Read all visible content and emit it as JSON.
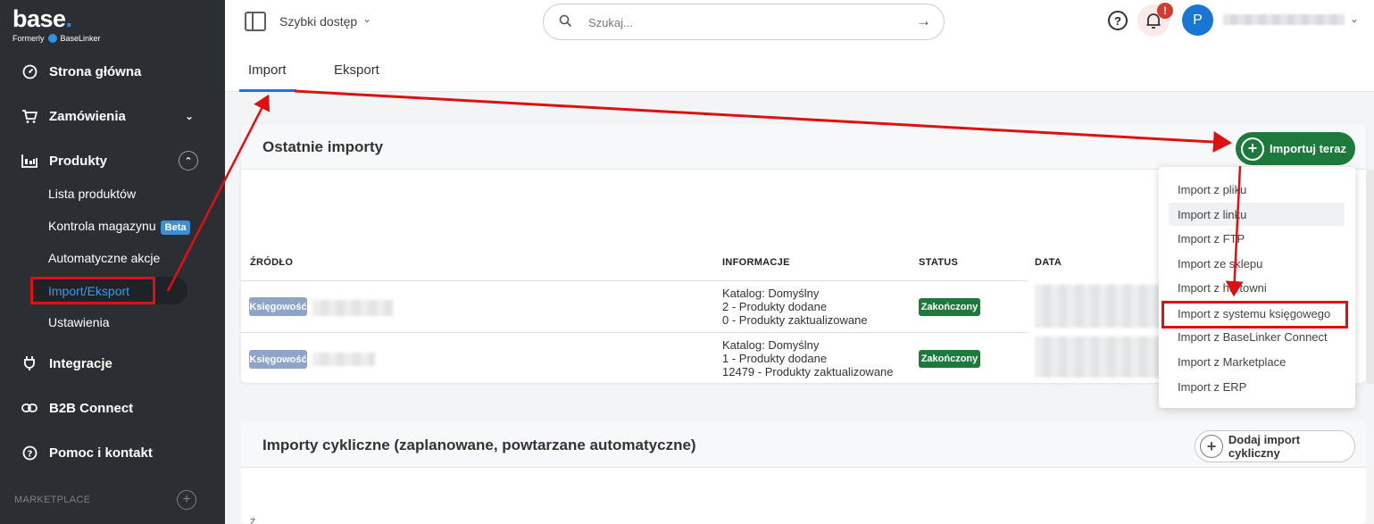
{
  "brand": {
    "name": "base",
    "dot": ".",
    "formerly": "Formerly",
    "formerly_brand": "BaseLinker"
  },
  "sidebar": {
    "items": [
      {
        "label": "Strona główna",
        "icon": "dashboard-icon"
      },
      {
        "label": "Zamówienia",
        "icon": "cart-icon"
      },
      {
        "label": "Produkty",
        "icon": "products-icon"
      },
      {
        "label": "Integracje",
        "icon": "plug-icon"
      },
      {
        "label": "B2B Connect",
        "icon": "link-icon"
      },
      {
        "label": "Pomoc i kontakt",
        "icon": "help-circle-icon"
      }
    ],
    "sub_items": [
      {
        "label": "Lista produktów"
      },
      {
        "label": "Kontrola magazynu",
        "badge": "Beta"
      },
      {
        "label": "Automatyczne akcje"
      },
      {
        "label": "Import/Eksport",
        "active": true
      },
      {
        "label": "Ustawienia"
      }
    ],
    "section_label": "MARKETPLACE"
  },
  "topbar": {
    "quick_access": "Szybki dostęp",
    "search_placeholder": "Szukaj...",
    "help": "?",
    "notification_badge": "!",
    "avatar_initial": "P"
  },
  "tabs": [
    {
      "label": "Import",
      "active": true
    },
    {
      "label": "Eksport",
      "active": false
    }
  ],
  "recent_imports": {
    "title": "Ostatnie importy",
    "import_button": "Importuj teraz",
    "columns": [
      "ŹRÓDŁO",
      "INFORMACJE",
      "STATUS",
      "DATA"
    ],
    "rows": [
      {
        "source": "Księgowość",
        "info": [
          "Katalog: Domyślny",
          "2 - Produkty dodane",
          "0 - Produkty zaktualizowane"
        ],
        "status": "Zakończony"
      },
      {
        "source": "Księgowość",
        "info": [
          "Katalog: Domyślny",
          "1 - Produkty dodane",
          "12479 - Produkty zaktualizowane"
        ],
        "status": "Zakończony"
      }
    ]
  },
  "import_menu": {
    "items": [
      "Import z pliku",
      "Import z linku",
      "Import z FTP",
      "Import ze sklepu",
      "Import z hurtowni",
      "Import z systemu księgowego",
      "Import z BaseLinker Connect",
      "Import z Marketplace",
      "Import z ERP"
    ]
  },
  "cyclic_imports": {
    "title": "Importy cykliczne (zaplanowane, powtarzane automatyczne)",
    "add_button": "Dodaj import cykliczny",
    "footer_fragment": "Ź"
  },
  "colors": {
    "sidebar_bg": "#2b2e33",
    "accent_blue": "#1a73e8",
    "success_green": "#1d7a3c",
    "annotation_red": "#e01010",
    "source_badge": "#8ea4c9"
  }
}
